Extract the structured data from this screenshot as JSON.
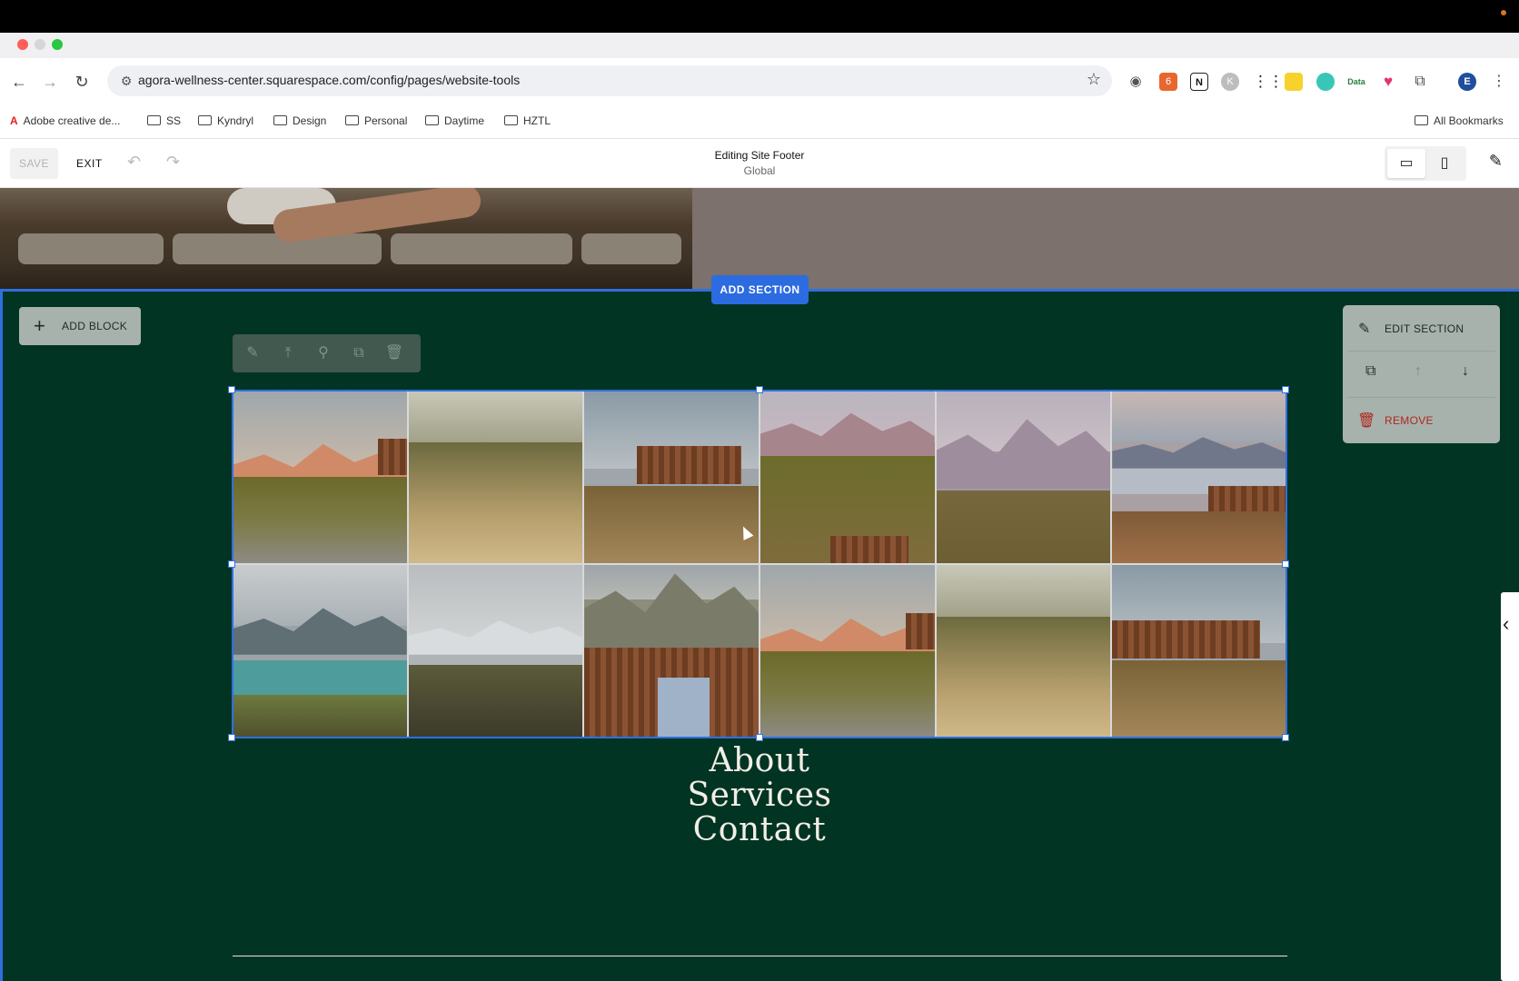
{
  "browser": {
    "url": "agora-wellness-center.squarespace.com/config/pages/website-tools",
    "bookmarks": [
      {
        "label": "Adobe creative de..."
      },
      {
        "label": "SS"
      },
      {
        "label": "Kyndryl"
      },
      {
        "label": "Design"
      },
      {
        "label": "Personal"
      },
      {
        "label": "Daytime"
      },
      {
        "label": "HZTL"
      }
    ],
    "all_bookmarks": "All Bookmarks",
    "profile_initial": "E",
    "extension_badge": "6",
    "ext_data_label": "Data"
  },
  "editor": {
    "save_label": "SAVE",
    "exit_label": "EXIT",
    "title": "Editing Site Footer",
    "subtitle": "Global"
  },
  "canvas": {
    "add_section_label": "ADD SECTION",
    "add_block_label": "ADD BLOCK",
    "section_panel": {
      "edit_label": "EDIT SECTION",
      "remove_label": "REMOVE"
    },
    "footer_links": [
      "About",
      "Services",
      "Contact"
    ]
  },
  "colors": {
    "accent": "#2f6fe0",
    "footer_bg": "#023424",
    "remove": "#b3261e"
  }
}
